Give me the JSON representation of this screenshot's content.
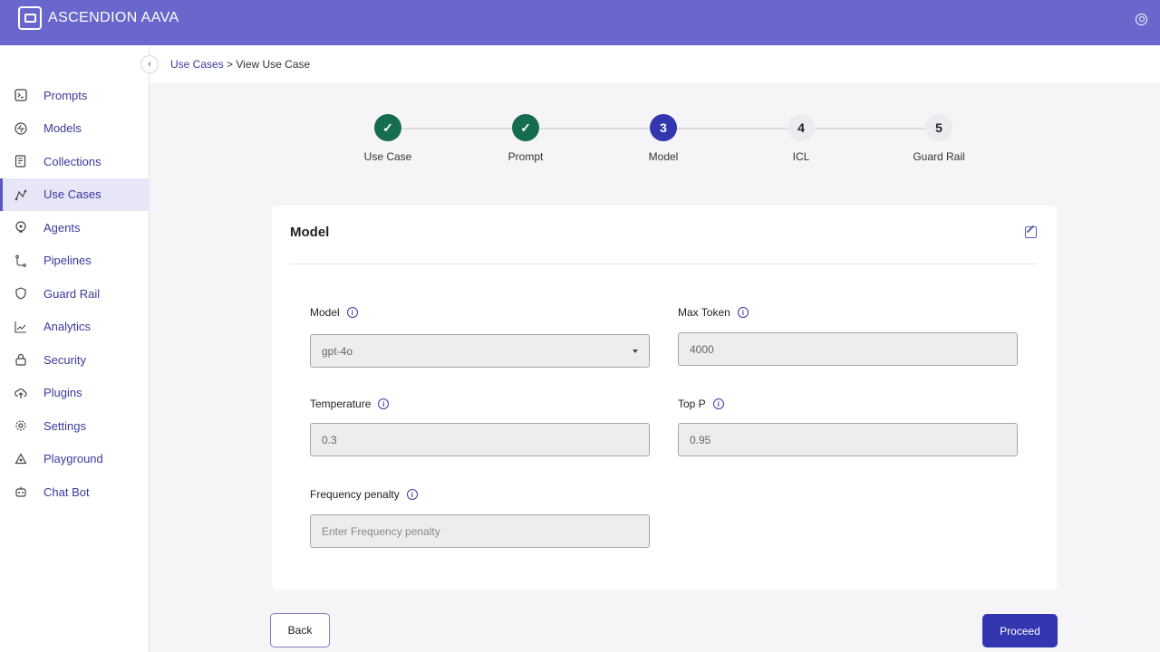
{
  "app": {
    "title": "ASCENDION AAVA"
  },
  "sidebar": {
    "items": [
      {
        "label": "Prompts",
        "icon": "terminal-icon",
        "active": false
      },
      {
        "label": "Models",
        "icon": "model-icon",
        "active": false
      },
      {
        "label": "Collections",
        "icon": "collection-icon",
        "active": false
      },
      {
        "label": "Use Cases",
        "icon": "usecase-icon",
        "active": true
      },
      {
        "label": "Agents",
        "icon": "agent-icon",
        "active": false
      },
      {
        "label": "Pipelines",
        "icon": "pipeline-icon",
        "active": false
      },
      {
        "label": "Guard Rail",
        "icon": "shield-icon",
        "active": false
      },
      {
        "label": "Analytics",
        "icon": "chart-icon",
        "active": false
      },
      {
        "label": "Security",
        "icon": "lock-icon",
        "active": false
      },
      {
        "label": "Plugins",
        "icon": "cloud-upload-icon",
        "active": false
      },
      {
        "label": "Settings",
        "icon": "gear-icon",
        "active": false
      },
      {
        "label": "Playground",
        "icon": "playground-icon",
        "active": false
      },
      {
        "label": "Chat Bot",
        "icon": "bot-icon",
        "active": false
      }
    ]
  },
  "breadcrumb": {
    "parent": "Use Cases",
    "separator": " > ",
    "current": "View Use Case"
  },
  "stepper": {
    "steps": [
      {
        "label": "Use Case",
        "marker": "✓",
        "state": "done"
      },
      {
        "label": "Prompt",
        "marker": "✓",
        "state": "done"
      },
      {
        "label": "Model",
        "marker": "3",
        "state": "current"
      },
      {
        "label": "ICL",
        "marker": "4",
        "state": "todo"
      },
      {
        "label": "Guard Rail",
        "marker": "5",
        "state": "todo"
      }
    ]
  },
  "card": {
    "title": "Model",
    "fields": {
      "model": {
        "label": "Model",
        "value": "gpt-4o"
      },
      "max_token": {
        "label": "Max Token",
        "value": "4000"
      },
      "temperature": {
        "label": "Temperature",
        "value": "0.3"
      },
      "top_p": {
        "label": "Top P",
        "value": "0.95"
      },
      "frequency_penalty": {
        "label": "Frequency penalty",
        "placeholder": "Enter Frequency penalty"
      }
    }
  },
  "actions": {
    "back": "Back",
    "proceed": "Proceed"
  },
  "colors": {
    "topbar": "#6967cc",
    "primary": "#3436b0",
    "done": "#166c4f"
  }
}
